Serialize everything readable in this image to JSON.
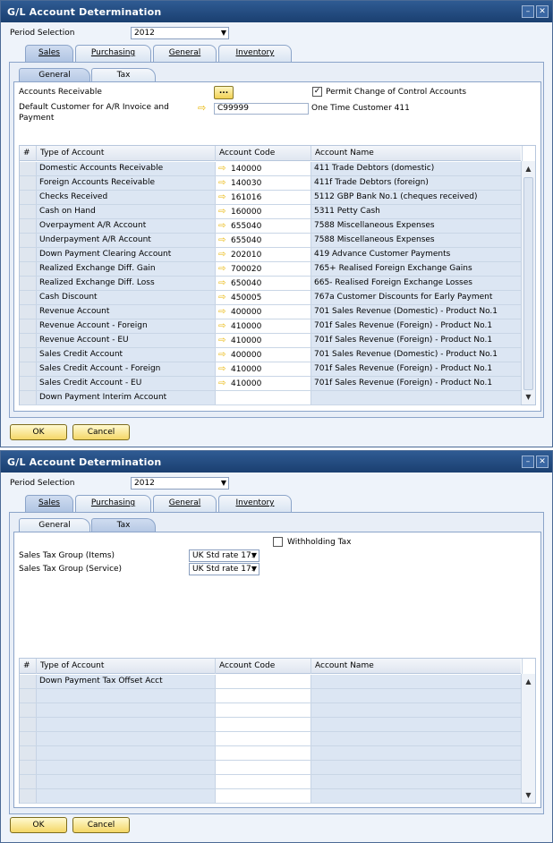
{
  "windows": [
    {
      "title": "G/L Account Determination",
      "period_label": "Period Selection",
      "period_value": "2012",
      "tabs": [
        "Sales",
        "Purchasing",
        "General",
        "Inventory"
      ],
      "subtabs": [
        "General",
        "Tax"
      ],
      "fields": {
        "ar_label": "Accounts Receivable",
        "dots": "...",
        "permit_label": "Permit Change of Control Accounts",
        "customer_label": "Default Customer for A/R Invoice and Payment",
        "customer_code": "C99999",
        "customer_name": "One Time Customer 411"
      },
      "table": {
        "headers": [
          "#",
          "Type of Account",
          "Account Code",
          "Account Name"
        ],
        "rows": [
          {
            "type": "Domestic Accounts Receivable",
            "code": "140000",
            "name": "411 Trade Debtors (domestic)"
          },
          {
            "type": "Foreign Accounts Receivable",
            "code": "140030",
            "name": "411f Trade Debtors (foreign)"
          },
          {
            "type": "Checks Received",
            "code": "161016",
            "name": "5112 GBP Bank No.1 (cheques received)"
          },
          {
            "type": "Cash on Hand",
            "code": "160000",
            "name": "5311 Petty Cash"
          },
          {
            "type": "Overpayment A/R Account",
            "code": "655040",
            "name": "7588 Miscellaneous Expenses"
          },
          {
            "type": "Underpayment A/R Account",
            "code": "655040",
            "name": "7588 Miscellaneous Expenses"
          },
          {
            "type": "Down Payment Clearing Account",
            "code": "202010",
            "name": "419 Advance Customer Payments"
          },
          {
            "type": "Realized Exchange Diff. Gain",
            "code": "700020",
            "name": "765+ Realised Foreign Exchange Gains"
          },
          {
            "type": "Realized Exchange Diff. Loss",
            "code": "650040",
            "name": "665- Realised Foreign Exchange Losses"
          },
          {
            "type": "Cash Discount",
            "code": "450005",
            "name": "767a Customer Discounts for Early Payment"
          },
          {
            "type": "Revenue Account",
            "code": "400000",
            "name": "701 Sales Revenue (Domestic) - Product No.1"
          },
          {
            "type": "Revenue Account - Foreign",
            "code": "410000",
            "name": "701f Sales Revenue (Foreign) - Product No.1"
          },
          {
            "type": "Revenue Account - EU",
            "code": "410000",
            "name": "701f Sales Revenue (Foreign) - Product No.1"
          },
          {
            "type": "Sales Credit Account",
            "code": "400000",
            "name": "701 Sales Revenue (Domestic) - Product No.1"
          },
          {
            "type": "Sales Credit Account - Foreign",
            "code": "410000",
            "name": "701f Sales Revenue (Foreign) - Product No.1"
          },
          {
            "type": "Sales Credit Account - EU",
            "code": "410000",
            "name": "701f Sales Revenue (Foreign) - Product No.1"
          },
          {
            "type": "Down Payment Interim Account",
            "code": "",
            "name": ""
          }
        ]
      },
      "ok": "OK",
      "cancel": "Cancel"
    },
    {
      "title": "G/L Account Determination",
      "period_label": "Period Selection",
      "period_value": "2012",
      "tabs": [
        "Sales",
        "Purchasing",
        "General",
        "Inventory"
      ],
      "subtabs": [
        "General",
        "Tax"
      ],
      "fields": {
        "withholding_label": "Withholding Tax",
        "items_label": "Sales Tax Group (Items)",
        "items_value": "UK Std rate 17.",
        "service_label": "Sales Tax Group (Service)",
        "service_value": "UK Std rate 17."
      },
      "table": {
        "headers": [
          "#",
          "Type of Account",
          "Account Code",
          "Account Name"
        ],
        "rows": [
          {
            "type": "Down Payment Tax Offset Acct",
            "code": "",
            "name": ""
          }
        ]
      },
      "ok": "OK",
      "cancel": "Cancel"
    }
  ]
}
